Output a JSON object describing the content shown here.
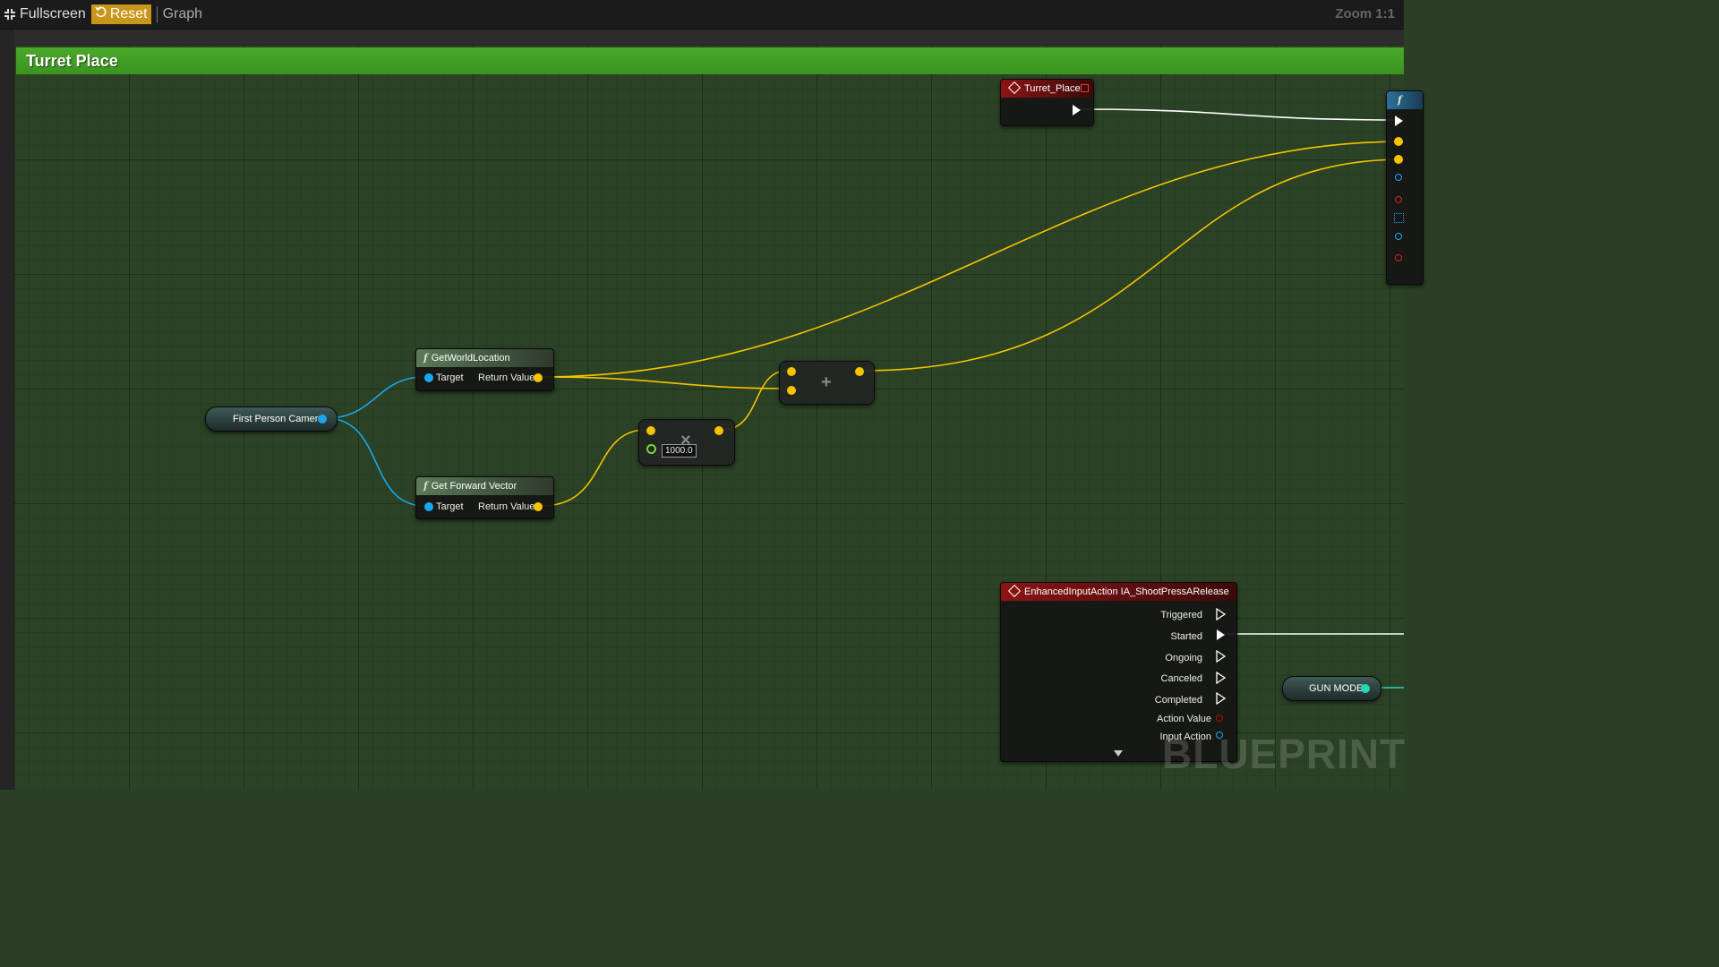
{
  "toolbar": {
    "fullscreen_label": "Fullscreen",
    "reset_label": "Reset",
    "graph_label": "Graph",
    "zoom_label": "Zoom 1:1"
  },
  "comment": {
    "title": "Turret Place"
  },
  "nodes": {
    "turret_place_event": {
      "title": "Turret_Place"
    },
    "get_world_location": {
      "title": "GetWorldLocation",
      "target_label": "Target",
      "return_label": "Return Value"
    },
    "get_forward_vector": {
      "title": "Get Forward Vector",
      "target_label": "Target",
      "return_label": "Return Value"
    },
    "first_person_camera": {
      "label": "First Person Camera"
    },
    "multiply": {
      "symbol": "×",
      "value": "1000.0"
    },
    "add": {
      "symbol": "+"
    },
    "enhanced_input": {
      "title": "EnhancedInputAction IA_ShootPressARelease",
      "outputs": [
        "Triggered",
        "Started",
        "Ongoing",
        "Canceled",
        "Completed",
        "Action Value",
        "Input Action"
      ]
    },
    "gun_mode": {
      "label": "GUN MODE"
    },
    "func_partial": {
      "symbol": "f"
    }
  },
  "watermark": "BLUEPRINT",
  "colors": {
    "exec": "#ffffff",
    "object_pin": "#19a8f0",
    "vector_pin": "#f5c300",
    "float_pin": "#7ad63a",
    "bool_pin": "#26d6b6",
    "comment": "#3e9a22"
  }
}
